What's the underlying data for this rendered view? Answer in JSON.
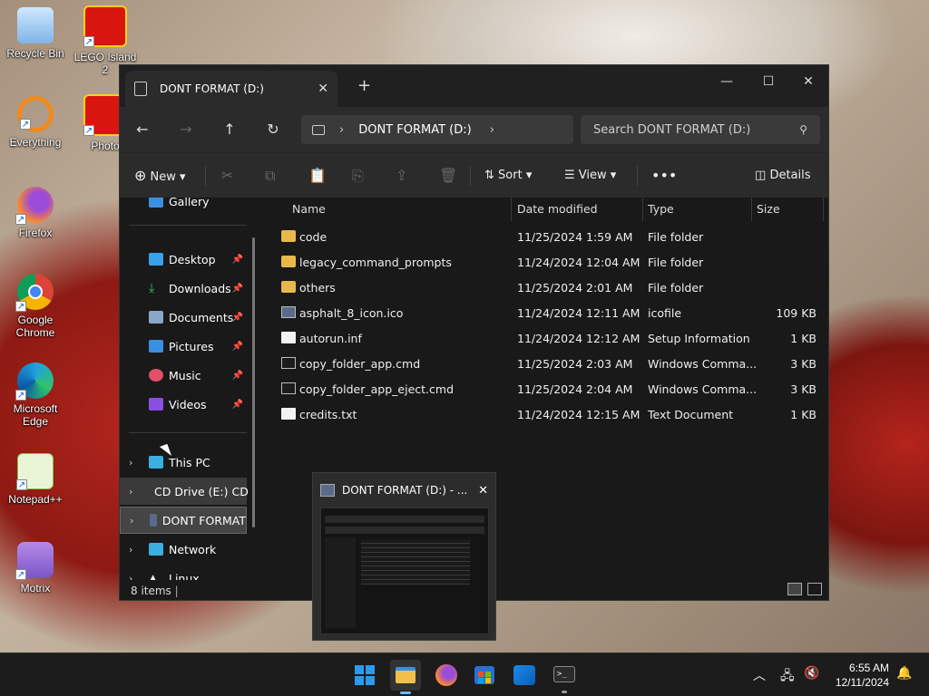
{
  "desktop": {
    "icons": [
      {
        "label": "Recycle Bin",
        "icon": "recycle-bin-icon"
      },
      {
        "label": "LEGO Island 2",
        "icon": "lego-icon"
      },
      {
        "label": "Everything",
        "icon": "everything-icon"
      },
      {
        "label": "Photo",
        "icon": "lego-icon"
      },
      {
        "label": "Firefox",
        "icon": "firefox-icon"
      },
      {
        "label": "Google Chrome",
        "icon": "chrome-icon"
      },
      {
        "label": "Microsoft Edge",
        "icon": "edge-icon"
      },
      {
        "label": "Notepad++",
        "icon": "notepadpp-icon"
      },
      {
        "label": "Motrix",
        "icon": "motrix-icon"
      }
    ]
  },
  "explorer": {
    "tab_title": "DONT FORMAT (D:)",
    "address": "DONT FORMAT (D:)",
    "search_placeholder": "Search DONT FORMAT (D:)",
    "toolbar": {
      "new": "New",
      "sort": "Sort",
      "view": "View",
      "details": "Details"
    },
    "nav": {
      "gallery": "Gallery",
      "desktop": "Desktop",
      "downloads": "Downloads",
      "documents": "Documents",
      "pictures": "Pictures",
      "music": "Music",
      "videos": "Videos",
      "this_pc": "This PC",
      "cd_drive": "CD Drive (E:) CD",
      "dont_format": "DONT FORMAT",
      "network": "Network",
      "linux": "Linux"
    },
    "columns": {
      "name": "Name",
      "date": "Date modified",
      "type": "Type",
      "size": "Size"
    },
    "files": [
      {
        "name": "code",
        "date": "11/25/2024 1:59 AM",
        "type": "File folder",
        "size": "",
        "kind": "folder"
      },
      {
        "name": "legacy_command_prompts",
        "date": "11/24/2024 12:04 AM",
        "type": "File folder",
        "size": "",
        "kind": "folder"
      },
      {
        "name": "others",
        "date": "11/25/2024 2:01 AM",
        "type": "File folder",
        "size": "",
        "kind": "folder"
      },
      {
        "name": "asphalt_8_icon.ico",
        "date": "11/24/2024 12:11 AM",
        "type": "icofile",
        "size": "109 KB",
        "kind": "ico"
      },
      {
        "name": "autorun.inf",
        "date": "11/24/2024 12:12 AM",
        "type": "Setup Information",
        "size": "1 KB",
        "kind": "file"
      },
      {
        "name": "copy_folder_app.cmd",
        "date": "11/25/2024 2:03 AM",
        "type": "Windows Comma...",
        "size": "3 KB",
        "kind": "cmd"
      },
      {
        "name": "copy_folder_app_eject.cmd",
        "date": "11/25/2024 2:04 AM",
        "type": "Windows Comma...",
        "size": "3 KB",
        "kind": "cmd"
      },
      {
        "name": "credits.txt",
        "date": "11/24/2024 12:15 AM",
        "type": "Text Document",
        "size": "1 KB",
        "kind": "file"
      }
    ],
    "status": "8 items"
  },
  "thumbnail": {
    "title": "DONT FORMAT (D:) - ..."
  },
  "taskbar": {
    "time": "6:55 AM",
    "date": "12/11/2024"
  }
}
